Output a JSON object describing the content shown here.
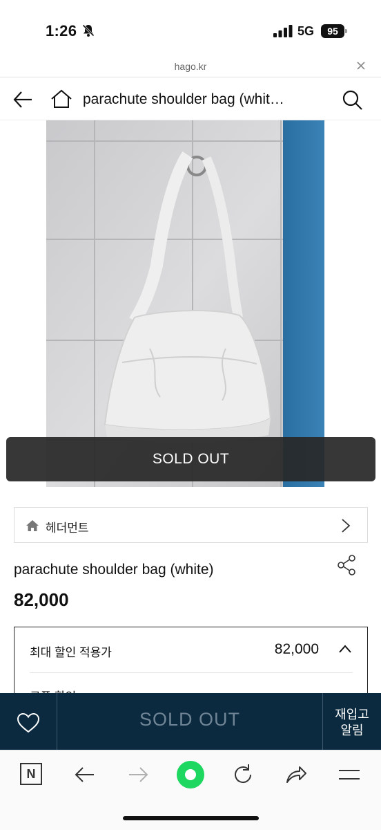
{
  "status_bar": {
    "time": "1:26",
    "network": "5G",
    "battery": "95"
  },
  "url_bar": {
    "domain": "hago.kr"
  },
  "header": {
    "title": "parachute shoulder bag (whit…"
  },
  "product": {
    "overlay_label": "SOLD OUT",
    "brand": "헤더먼트",
    "name": "parachute shoulder bag (white)",
    "price": "82,000"
  },
  "discount": {
    "label": "최대 할인 적용가",
    "value": "82,000",
    "coupon_label": "쿠폰 할인"
  },
  "buy_bar": {
    "sold_out_label": "SOLD OUT",
    "restock_line1": "재입고",
    "restock_line2": "알림"
  },
  "colors": {
    "buy_bar_bg": "#0b2a3f",
    "overlay_bg": "#282828",
    "toolbar_accent": "#1ed760"
  },
  "icons": [
    "bell-slash-icon",
    "signal-icon",
    "close-icon",
    "back-arrow-icon",
    "home-icon",
    "search-icon",
    "chevron-right-icon",
    "share-icon",
    "chevron-up-icon",
    "heart-icon",
    "forward-arrow-icon",
    "reload-icon",
    "share-arrow-icon",
    "menu-icon"
  ]
}
